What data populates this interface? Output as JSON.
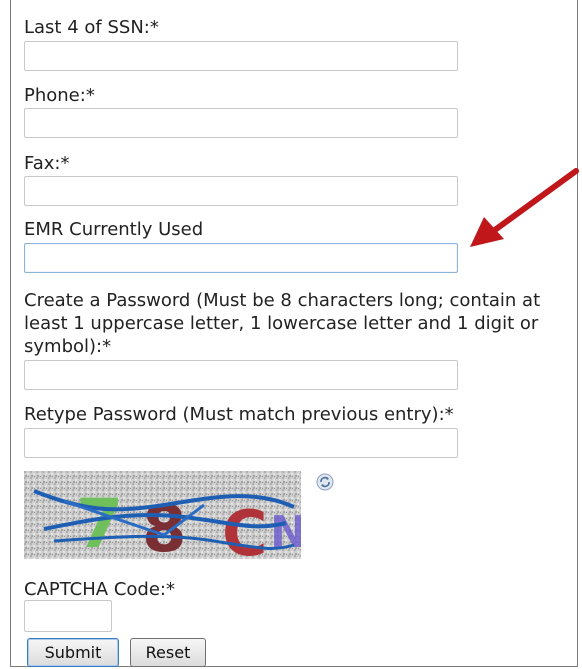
{
  "form": {
    "ssn_label": "Last 4 of SSN:*",
    "ssn_value": "",
    "phone_label": "Phone:*",
    "phone_value": "",
    "fax_label": "Fax:*",
    "fax_value": "",
    "emr_label": "EMR Currently Used",
    "emr_value": "",
    "password_label": "Create a Password (Must be 8 characters long; contain at least 1 uppercase letter, 1 lowercase letter and 1 digit or symbol):*",
    "password_value": "",
    "retype_label": "Retype Password (Must match previous entry):*",
    "retype_value": "",
    "captcha_text": "78CN",
    "captcha_label": "CAPTCHA Code:*",
    "captcha_value": ""
  },
  "buttons": {
    "submit_label": "Submit",
    "reset_label": "Reset"
  },
  "icons": {
    "refresh": "refresh-icon",
    "annotation": "red-arrow-icon"
  },
  "colors": {
    "arrow": "#c0171b",
    "focused_border": "#8ab4dc",
    "primary_button_border": "#3d7bbf"
  }
}
